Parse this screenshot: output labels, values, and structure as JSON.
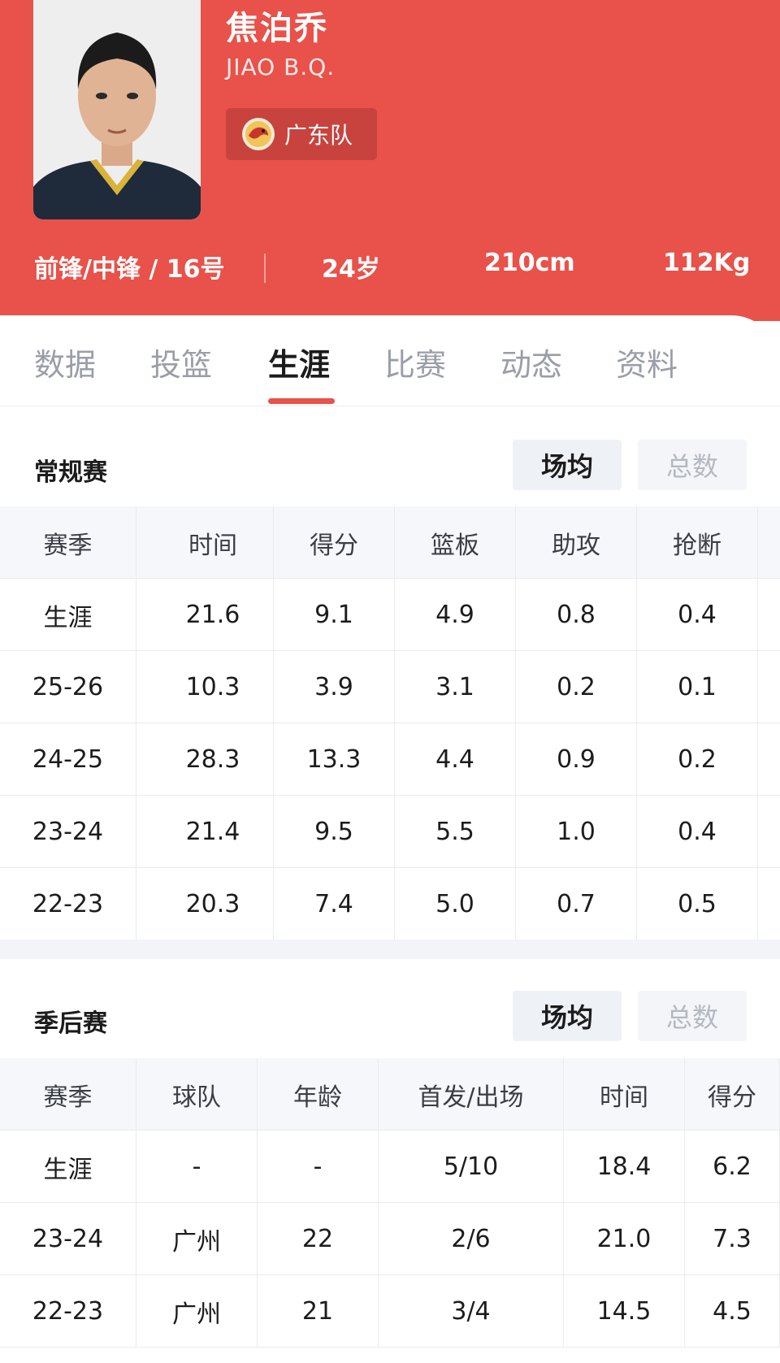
{
  "player": {
    "name_cn": "焦泊乔",
    "name_en": "JIAO B.Q.",
    "team": "广东队",
    "position_number": "前锋/中锋 / 16号",
    "age": "24岁",
    "height": "210cm",
    "weight": "112Kg"
  },
  "tabs": [
    {
      "label": "数据",
      "active": false
    },
    {
      "label": "投篮",
      "active": false
    },
    {
      "label": "生涯",
      "active": true
    },
    {
      "label": "比赛",
      "active": false
    },
    {
      "label": "动态",
      "active": false
    },
    {
      "label": "资料",
      "active": false
    }
  ],
  "regular": {
    "title": "常规赛",
    "toggle_avg": "场均",
    "toggle_total": "总数",
    "headers": [
      "赛季",
      "时间",
      "得分",
      "篮板",
      "助攻",
      "抢断"
    ],
    "rows": [
      [
        "生涯",
        "21.6",
        "9.1",
        "4.9",
        "0.8",
        "0.4"
      ],
      [
        "25-26",
        "10.3",
        "3.9",
        "3.1",
        "0.2",
        "0.1"
      ],
      [
        "24-25",
        "28.3",
        "13.3",
        "4.4",
        "0.9",
        "0.2"
      ],
      [
        "23-24",
        "21.4",
        "9.5",
        "5.5",
        "1.0",
        "0.4"
      ],
      [
        "22-23",
        "20.3",
        "7.4",
        "5.0",
        "0.7",
        "0.5"
      ]
    ]
  },
  "playoffs": {
    "title": "季后赛",
    "toggle_avg": "场均",
    "toggle_total": "总数",
    "headers": [
      "赛季",
      "球队",
      "年龄",
      "首发/出场",
      "时间",
      "得分"
    ],
    "rows": [
      [
        "生涯",
        "-",
        "-",
        "5/10",
        "18.4",
        "6.2"
      ],
      [
        "23-24",
        "广州",
        "22",
        "2/6",
        "21.0",
        "7.3"
      ],
      [
        "22-23",
        "广州",
        "21",
        "3/4",
        "14.5",
        "4.5"
      ]
    ]
  },
  "colors": {
    "accent": "#e8524a",
    "header_bg": "#e8524a"
  }
}
